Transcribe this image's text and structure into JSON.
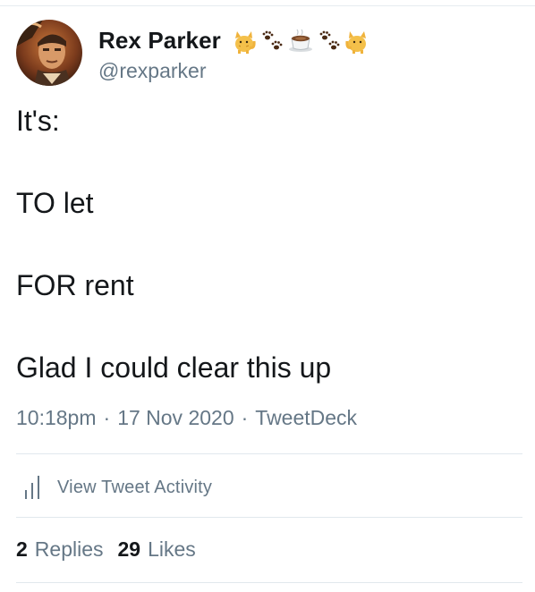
{
  "tweet": {
    "author": {
      "display_name": "Rex Parker",
      "handle": "@rexparker",
      "name_emojis": [
        "cat-emoji",
        "paw-prints-emoji",
        "coffee-emoji",
        "paw-prints-emoji",
        "cat-emoji"
      ]
    },
    "lines": [
      "It's:",
      "TO let",
      "FOR rent",
      "Glad I could clear this up"
    ],
    "time": "10:18pm",
    "separator": "·",
    "date": "17 Nov 2020",
    "source": "TweetDeck",
    "activity_label": "View Tweet Activity",
    "stats": {
      "replies_count": "2",
      "replies_label": "Replies",
      "likes_count": "29",
      "likes_label": "Likes"
    }
  },
  "colors": {
    "text_primary": "#14171a",
    "text_secondary": "#657786",
    "divider": "#e1e8ed"
  }
}
